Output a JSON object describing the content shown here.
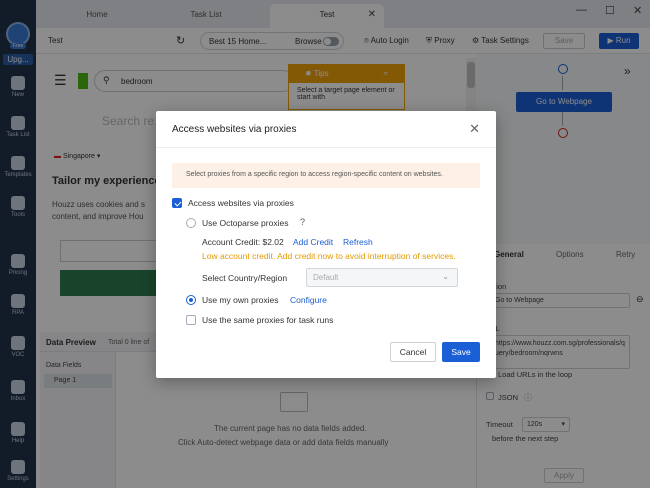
{
  "rail": {
    "free_badge": "Free",
    "upgrade": "Upg...",
    "items": [
      {
        "label": "New"
      },
      {
        "label": "Task List"
      },
      {
        "label": "Templates"
      },
      {
        "label": "Tools"
      },
      {
        "label": "Pricing"
      },
      {
        "label": "RPA"
      },
      {
        "label": "VOC"
      },
      {
        "label": "Inbox"
      },
      {
        "label": "Help"
      },
      {
        "label": "Settings"
      }
    ]
  },
  "tabs": [
    {
      "label": "Home"
    },
    {
      "label": "Task List"
    },
    {
      "label": "Test"
    }
  ],
  "toolbar": {
    "task_name": "Test",
    "template_pill": "Best 15 Home...",
    "browse_label": "Browse",
    "auto_login": "Auto Login",
    "proxy": "Proxy",
    "task_settings": "Task Settings",
    "save": "Save",
    "run": "Run"
  },
  "browser": {
    "search_value": "bedroom",
    "search_hint": "Search re...",
    "region": "Singapore",
    "heading": "Tailor my experience",
    "body_text": "Houzz uses cookies and s",
    "body_text2": "content, and improve Hou",
    "tips_title": "Tips",
    "tips_body": "Select a target page element or start with"
  },
  "data_preview": {
    "title": "Data Preview",
    "total": "Total 0 line of",
    "fields_label": "Data Fields",
    "page_label": "Page 1",
    "empty_line1": "The current page has no data fields added.",
    "empty_line2": "Click Auto-detect webpage data or add data fields manually"
  },
  "right_panel": {
    "goto_button": "Go to Webpage",
    "tab_general": "General",
    "tab_options": "Options",
    "tab_retry": "Retry",
    "action_label": "otion",
    "action_value": "Go to Webpage",
    "url_label": "RL",
    "url_value": "https://www.houzz.com.sg/professionals/query/bedroom/nqrwns",
    "load_urls": "Load URLs in the loop",
    "json": "JSON",
    "timeout_label": "Timeout",
    "timeout_value": "120s",
    "timeout_suffix": "before the next step",
    "apply": "Apply"
  },
  "modal": {
    "title": "Access websites via proxies",
    "notice": "Select proxies from a specific region to access region-specific content on websites.",
    "access_checkbox": "Access websites via proxies",
    "use_octoparse": "Use Octoparse proxies",
    "account_credit": "Account Credit: $2.02",
    "add_credit": "Add Credit",
    "refresh": "Refresh",
    "warning": "Low account credit. Add credit now to avoid interruption of services.",
    "country_label": "Select Country/Region",
    "country_value": "Default",
    "use_my_own": "Use my own proxies",
    "configure": "Configure",
    "same_proxies": "Use the same proxies for task runs",
    "cancel": "Cancel",
    "save": "Save"
  },
  "colors": {
    "accent": "#1a5fd6",
    "rail": "#22324a",
    "warning": "#e59a00",
    "tips": "#f0a30a"
  }
}
